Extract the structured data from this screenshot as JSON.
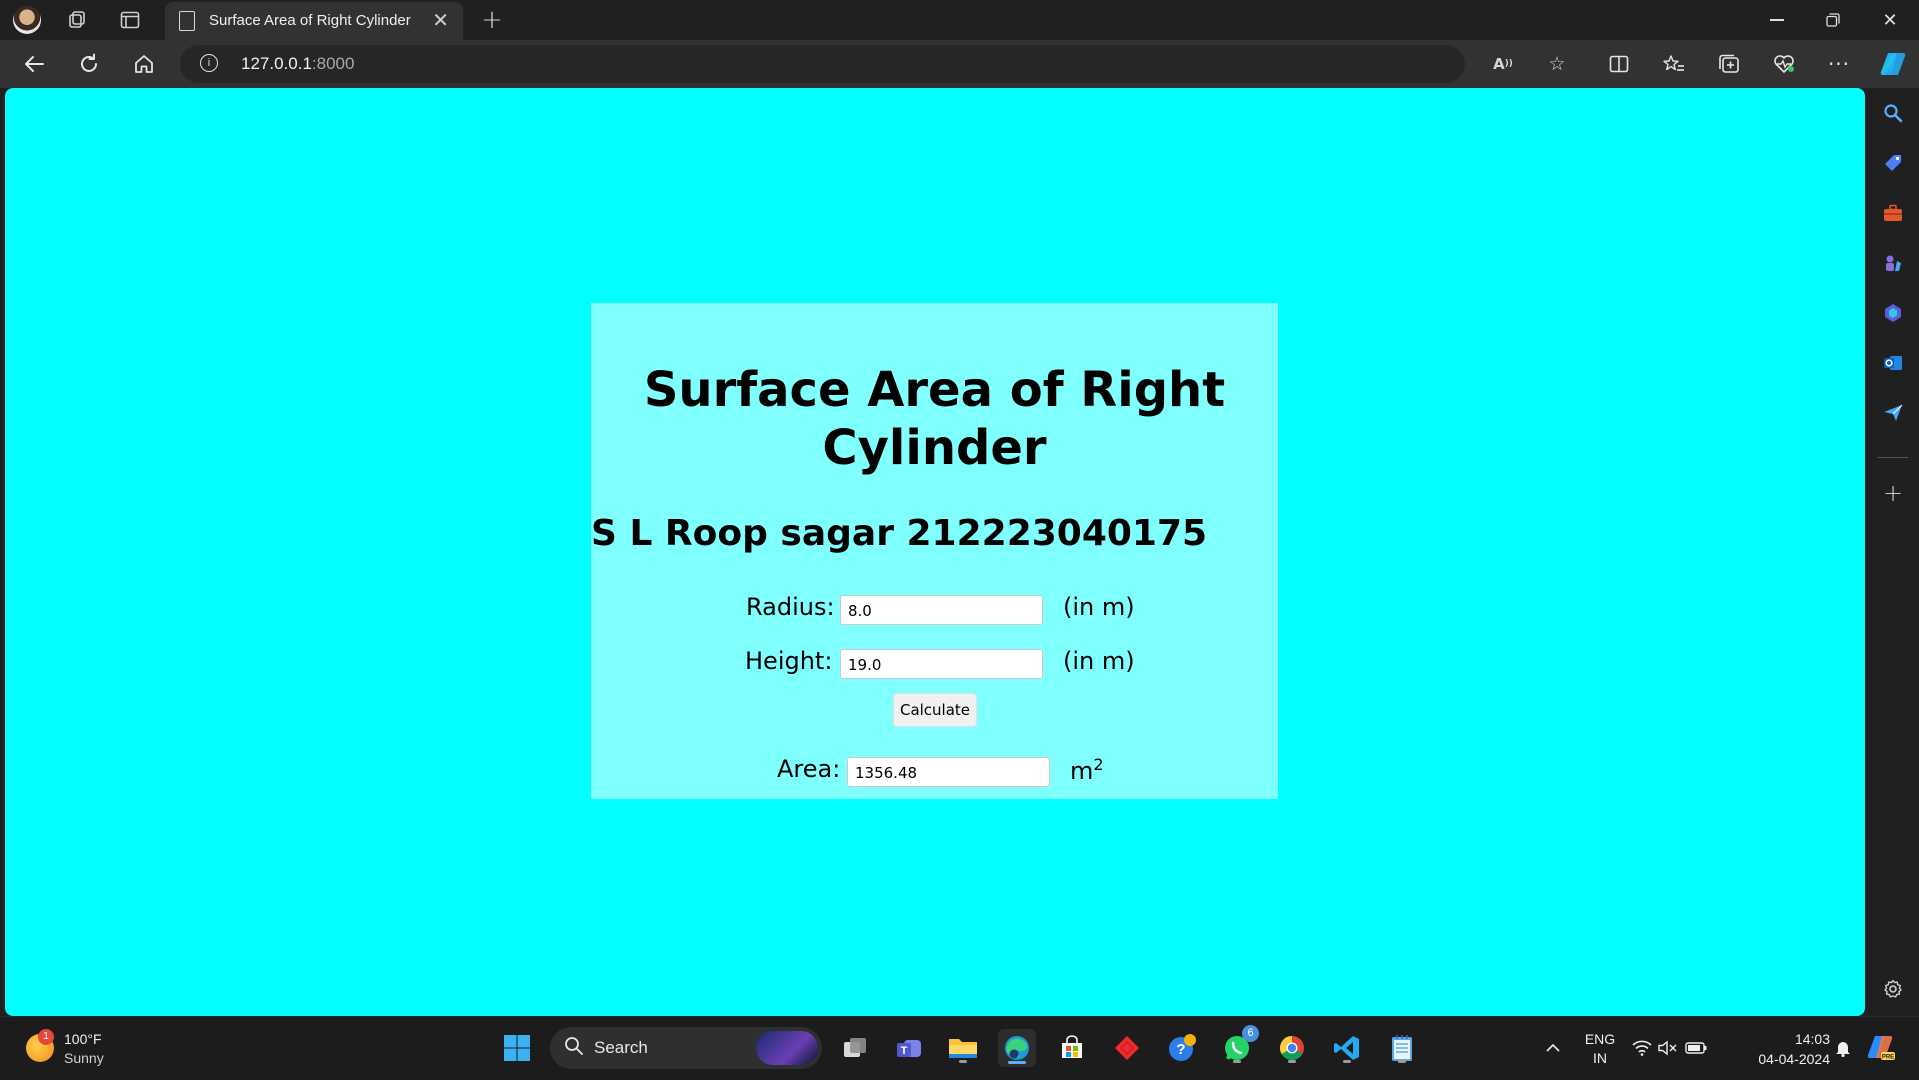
{
  "browser": {
    "tab_title": "Surface Area of Right Cylinder",
    "url_host": "127.0.0.1",
    "url_port": ":8000",
    "accent": "#00ffff"
  },
  "page": {
    "heading": "Surface Area of Right Cylinder",
    "author": "S L Roop sagar 212223040175",
    "radius_label": "Radius:",
    "radius_value": "8.0",
    "radius_unit": "(in m)",
    "height_label": "Height:",
    "height_value": "19.0",
    "height_unit": "(in m)",
    "calculate_label": "Calculate",
    "area_label": "Area:",
    "area_value": "1356.48",
    "area_unit": "m",
    "area_unit_sup": "2"
  },
  "taskbar": {
    "weather_temp": "100°F",
    "weather_desc": "Sunny",
    "weather_badge": "1",
    "search_label": "Search",
    "whatsapp_badge": "6",
    "lang_1": "ENG",
    "lang_2": "IN",
    "time": "14:03",
    "date": "04-04-2024"
  }
}
